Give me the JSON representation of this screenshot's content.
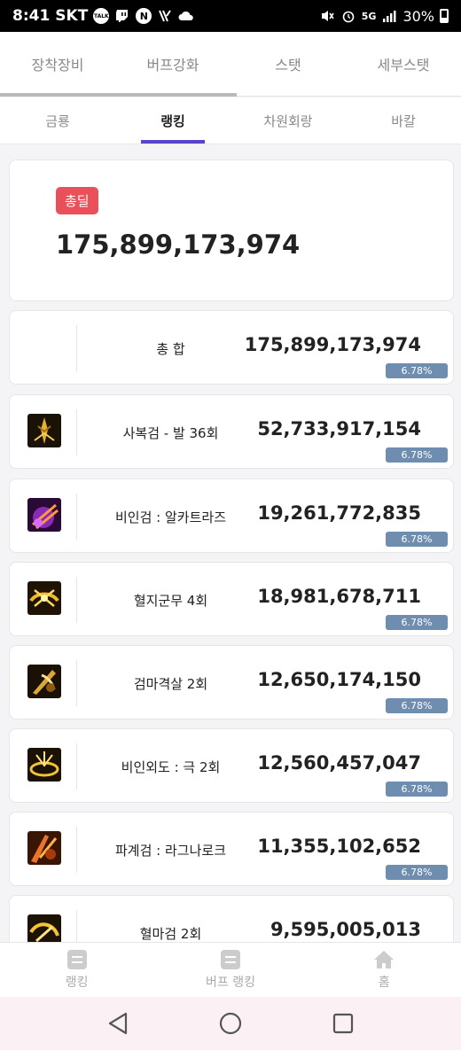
{
  "status_bar": {
    "time": "8:41",
    "carrier": "SKT",
    "talk_label": "TALK",
    "n_label": "N",
    "battery": "30%",
    "network": "5G",
    "icons": [
      "kakaotalk-icon",
      "twitch-icon",
      "naver-icon",
      "vpn-icon",
      "cloud-icon",
      "mute-icon",
      "alarm-icon",
      "signal-icon",
      "battery-icon"
    ]
  },
  "main_tabs": [
    {
      "label": "장착장비"
    },
    {
      "label": "버프강화"
    },
    {
      "label": "스탯"
    },
    {
      "label": "세부스탯"
    }
  ],
  "sub_tabs": [
    {
      "label": "금룡",
      "active": false
    },
    {
      "label": "랭킹",
      "active": true
    },
    {
      "label": "차원회랑",
      "active": false
    },
    {
      "label": "바칼",
      "active": false
    }
  ],
  "total": {
    "badge": "총딜",
    "value": "175,899,173,974",
    "badge_color": "#e9505a"
  },
  "skills": [
    {
      "name": "총 합",
      "damage": "175,899,173,974",
      "pct": "6.78%",
      "icon": ""
    },
    {
      "name": "사복검 - 발 36회",
      "damage": "52,733,917,154",
      "pct": "6.78%",
      "icon": "sabokgeom-skill-icon"
    },
    {
      "name": "비인검 : 알카트라즈",
      "damage": "19,261,772,835",
      "pct": "6.78%",
      "icon": "alcatraz-skill-icon"
    },
    {
      "name": "혈지군무 4회",
      "damage": "18,981,678,711",
      "pct": "6.78%",
      "icon": "hyeoljigunmu-skill-icon"
    },
    {
      "name": "검마격살 2회",
      "damage": "12,650,174,150",
      "pct": "6.78%",
      "icon": "geommagyeoksal-skill-icon"
    },
    {
      "name": "비인외도 : 극 2회",
      "damage": "12,560,457,047",
      "pct": "6.78%",
      "icon": "biinoedo-skill-icon"
    },
    {
      "name": "파계검 : 라그나로크",
      "damage": "11,355,102,652",
      "pct": "6.78%",
      "icon": "ragnarok-skill-icon"
    },
    {
      "name": "혈마검 2회",
      "damage": "9,595,005,013",
      "pct": "",
      "icon": "hyeolmageom-skill-icon"
    }
  ],
  "bottom_nav": [
    {
      "label": "랭킹",
      "icon": "list-icon"
    },
    {
      "label": "버프 랭킹",
      "icon": "list-icon"
    },
    {
      "label": "홈",
      "icon": "home-icon"
    }
  ],
  "colors": {
    "accent": "#5644c9",
    "pct_badge": "#6f8daf"
  }
}
